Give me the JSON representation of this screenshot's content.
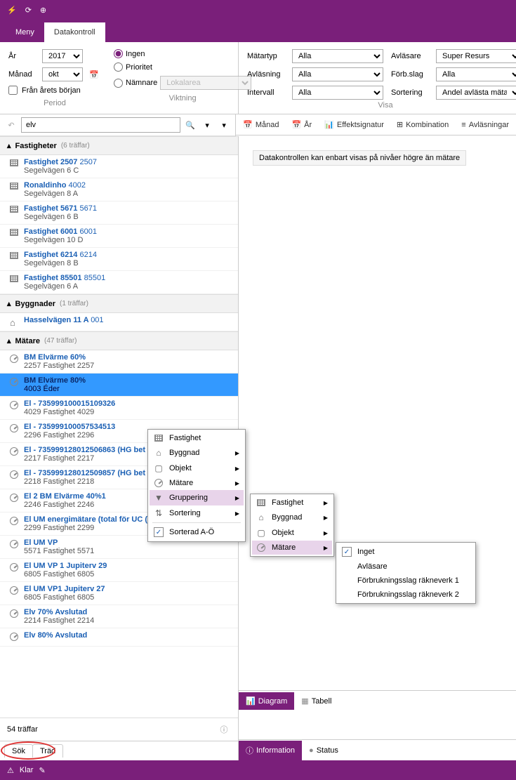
{
  "tabs": {
    "menu": "Meny",
    "data": "Datakontroll"
  },
  "period": {
    "year_label": "År",
    "year": "2017",
    "month_label": "Månad",
    "month": "okt",
    "from_start": "Från årets början",
    "caption": "Period"
  },
  "weighting": {
    "none": "Ingen",
    "priority": "Prioritet",
    "denominator": "Nämnare",
    "area": "Lokalarea",
    "caption": "Viktning"
  },
  "visa": {
    "matartyp_l": "Mätartyp",
    "matartyp": "Alla",
    "avl_l": "Avläsning",
    "avl": "Alla",
    "intervall_l": "Intervall",
    "intervall": "Alla",
    "avlasare_l": "Avläsare",
    "avlasare": "Super Resurs",
    "forb_l": "Förb.slag",
    "forb": "Alla",
    "sort_l": "Sortering",
    "sort": "Andel avlästa mätare",
    "caption": "Visa"
  },
  "viewbar": {
    "manad": "Månad",
    "ar": "År",
    "effekt": "Effektsignatur",
    "komb": "Kombination",
    "avlas": "Avläsningar"
  },
  "search": {
    "value": "elv"
  },
  "groups": {
    "fast": {
      "title": "Fastigheter",
      "count": "(6 träffar)"
    },
    "bygg": {
      "title": "Byggnader",
      "count": "(1 träffar)"
    },
    "mat": {
      "title": "Mätare",
      "count": "(47 träffar)"
    }
  },
  "fastigheter": [
    {
      "name": "Fastighet 2507",
      "num": "2507",
      "sub": "Segelvägen 6 C"
    },
    {
      "name": "Ronaldinho",
      "num": "4002",
      "sub": "Segelvägen 8 A"
    },
    {
      "name": "Fastighet 5671",
      "num": "5671",
      "sub": "Segelvägen 6 B"
    },
    {
      "name": "Fastighet 6001",
      "num": "6001",
      "sub": "Segelvägen 10 D"
    },
    {
      "name": "Fastighet 6214",
      "num": "6214",
      "sub": "Segelvägen 8 B"
    },
    {
      "name": "Fastighet 85501",
      "num": "85501",
      "sub": "Segelvägen 6 A"
    }
  ],
  "byggnader": [
    {
      "name": "Hasselvägen 11 A",
      "num": "001"
    }
  ],
  "matare": [
    {
      "name": "BM Elvärme 60%",
      "sub": "2257 Fastighet 2257"
    },
    {
      "name": "BM Elvärme 80%",
      "sub": "4003 Éder",
      "selected": true
    },
    {
      "name": "El - 735999100015109326",
      "sub": "4029 Fastighet 4029"
    },
    {
      "name": "El - 735999100057534513",
      "sub": "2296 Fastighet 2296"
    },
    {
      "name": "El - 735999128012506863 (HG bet",
      "sub": "2217 Fastighet 2217"
    },
    {
      "name": "El - 735999128012509857 (HG bet",
      "sub": "2218 Fastighet 2218"
    },
    {
      "name": "El 2 BM Elvärme 40%1",
      "sub": "2246 Fastighet 2246"
    },
    {
      "name": "El UM energimätare (total för UC (VP+PUMPAR+VMM+",
      "sub": "2299 Fastighet 2299"
    },
    {
      "name": "El UM VP",
      "sub": "5571 Fastighet 5571"
    },
    {
      "name": "El UM VP 1 Jupiterv 29",
      "sub": "6805 Fastighet 6805"
    },
    {
      "name": "El UM VP1 Jupiterv 27",
      "sub": "6805 Fastighet 6805"
    },
    {
      "name": "Elv 70% Avslutad",
      "sub": "2214 Fastighet 2214"
    },
    {
      "name": "Elv 80% Avslutad",
      "sub": ""
    }
  ],
  "content_msg": "Datakontrollen kan enbart visas på nivåer högre än mätare",
  "diagram_tabs": {
    "diagram": "Diagram",
    "tabell": "Tabell"
  },
  "info_tabs": {
    "info": "Information",
    "status": "Status"
  },
  "result_count": "54 träffar",
  "side_tabs": {
    "sok": "Sök",
    "trad": "Träd"
  },
  "footer": {
    "klar": "Klar"
  },
  "ctx1": {
    "fastighet": "Fastighet",
    "byggnad": "Byggnad",
    "objekt": "Objekt",
    "matare": "Mätare",
    "gruppering": "Gruppering",
    "sortering": "Sortering",
    "sorterad": "Sorterad A-Ö"
  },
  "ctx2": {
    "fastighet": "Fastighet",
    "byggnad": "Byggnad",
    "objekt": "Objekt",
    "matare": "Mätare"
  },
  "ctx3": {
    "inget": "Inget",
    "avlasare": "Avläsare",
    "f1": "Förbrukningsslag räkneverk 1",
    "f2": "Förbrukningsslag räkneverk 2"
  }
}
